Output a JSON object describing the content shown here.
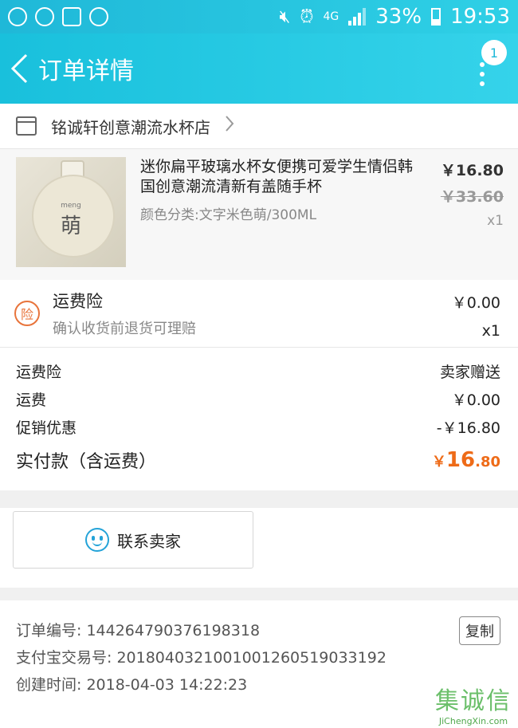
{
  "status_bar": {
    "network": "4G",
    "battery": "33%",
    "time": "19:53"
  },
  "header": {
    "title": "订单详情",
    "badge_count": "1"
  },
  "shop": {
    "name": "铭诚轩创意潮流水杯店"
  },
  "product": {
    "name": "迷你扁平玻璃水杯女便携可爱学生情侣韩国创意潮流清新有盖随手杯",
    "variant": "颜色分类:文字米色萌/300ML",
    "price": "￥16.80",
    "original_price": "￥33.60",
    "quantity": "x1",
    "image_label_small": "meng",
    "image_label_big": "萌"
  },
  "insurance": {
    "icon_char": "险",
    "title": "运费险",
    "subtitle": "确认收货前退货可理赔",
    "price": "￥0.00",
    "quantity": "x1"
  },
  "summary": {
    "rows": [
      {
        "label": "运费险",
        "value": "卖家赠送"
      },
      {
        "label": "运费",
        "value": "￥0.00"
      },
      {
        "label": "促销优惠",
        "value": "-￥16.80"
      }
    ],
    "total_label": "实付款（含运费）",
    "total_currency": "￥",
    "total_integer": "16",
    "total_decimal": ".80"
  },
  "contact": {
    "label": "联系卖家"
  },
  "order_info": {
    "order_no": "订单编号: 1442647903761983l8",
    "alipay_no": "支付宝交易号: 2018040321001001260519033192",
    "created": "创建时间: 2018-04-03 14:22:23",
    "copy_label": "复制"
  },
  "watermark": {
    "logo": "集诚信",
    "url": "JiChengXin.com"
  },
  "colors": {
    "header_teal": "#1fb8d8",
    "price_orange": "#ee6b18",
    "insurance_orange": "#e8743b",
    "contact_blue": "#24a3d8"
  }
}
